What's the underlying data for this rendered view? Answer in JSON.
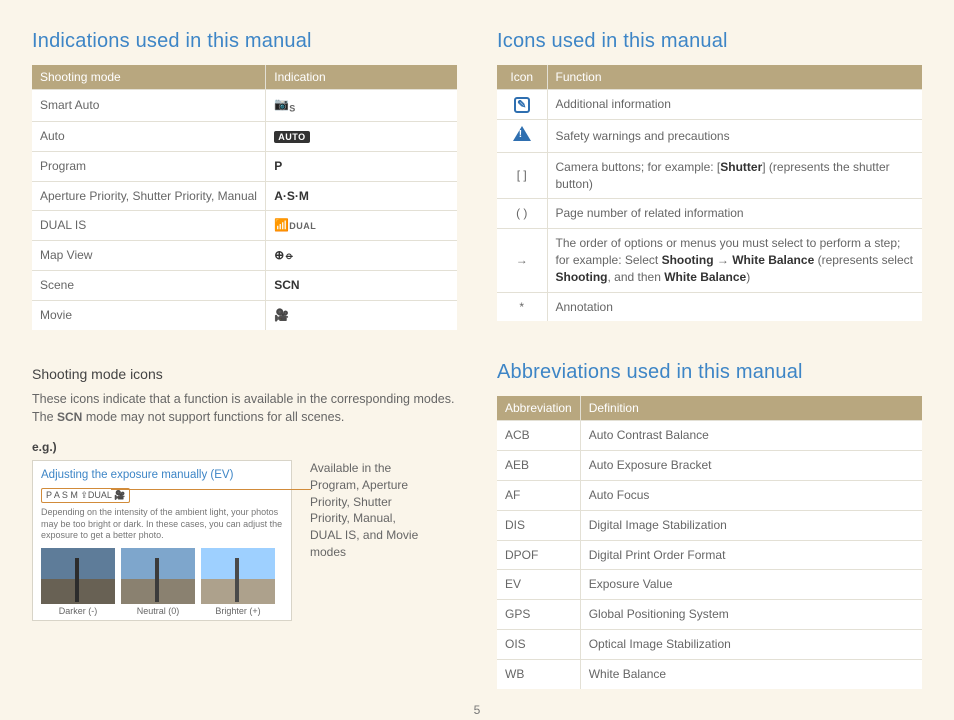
{
  "left": {
    "heading": "Indications used in this manual",
    "table": {
      "h1": "Shooting mode",
      "h2": "Indication",
      "rows": [
        {
          "mode": "Smart Auto",
          "icon": "smart-auto"
        },
        {
          "mode": "Auto",
          "icon": "auto"
        },
        {
          "mode": "Program",
          "icon": "P"
        },
        {
          "mode": "Aperture Priority, Shutter Priority, Manual",
          "icon": "A·S·M"
        },
        {
          "mode": "DUAL IS",
          "icon": "dual"
        },
        {
          "mode": "Map View",
          "icon": "map"
        },
        {
          "mode": "Scene",
          "icon": "SCN"
        },
        {
          "mode": "Movie",
          "icon": "movie"
        }
      ]
    },
    "sub": {
      "title": "Shooting mode icons",
      "text1": "These icons indicate that a function is available in the corresponding modes. The ",
      "scn": "SCN",
      "text2": " mode may not support functions for all scenes.",
      "eg": "e.g.)",
      "card": {
        "title": "Adjusting the exposure manually (EV)",
        "strip": "P A S M ⇪DUAL 🎥",
        "desc": "Depending on the intensity of the ambient light, your photos may be too bright or dark. In these cases, you can adjust the exposure to get a better photo.",
        "cap1": "Darker (-)",
        "cap2": "Neutral (0)",
        "cap3": "Brighter (+)"
      },
      "note": "Available in the Program, Aperture Priority, Shutter Priority, Manual, DUAL IS, and Movie modes"
    }
  },
  "right": {
    "heading1": "Icons used in this manual",
    "icons": {
      "h1": "Icon",
      "h2": "Function",
      "rows": [
        {
          "k": "info",
          "v": "Additional information"
        },
        {
          "k": "warn",
          "v": "Safety warnings and precautions"
        },
        {
          "k": "[ ]",
          "v": "Camera buttons; for example: [<b>Shutter</b>] (represents the shutter button)"
        },
        {
          "k": "( )",
          "v": "Page number of related information"
        },
        {
          "k": "→",
          "v": "The order of options or menus you must select to perform a step; for example: Select <b>Shooting</b> → <b>White Balance</b> (represents select <b>Shooting</b>, and then <b>White Balance</b>)"
        },
        {
          "k": "*",
          "v": "Annotation"
        }
      ]
    },
    "heading2": "Abbreviations used in this manual",
    "abbr": {
      "h1": "Abbreviation",
      "h2": "Definition",
      "rows": [
        {
          "a": "ACB",
          "d": "Auto Contrast Balance"
        },
        {
          "a": "AEB",
          "d": "Auto Exposure Bracket"
        },
        {
          "a": "AF",
          "d": "Auto Focus"
        },
        {
          "a": "DIS",
          "d": "Digital Image Stabilization"
        },
        {
          "a": "DPOF",
          "d": "Digital Print Order Format"
        },
        {
          "a": "EV",
          "d": "Exposure Value"
        },
        {
          "a": "GPS",
          "d": "Global Positioning System"
        },
        {
          "a": "OIS",
          "d": "Optical Image Stabilization"
        },
        {
          "a": "WB",
          "d": "White Balance"
        }
      ]
    }
  },
  "pagenum": "5"
}
